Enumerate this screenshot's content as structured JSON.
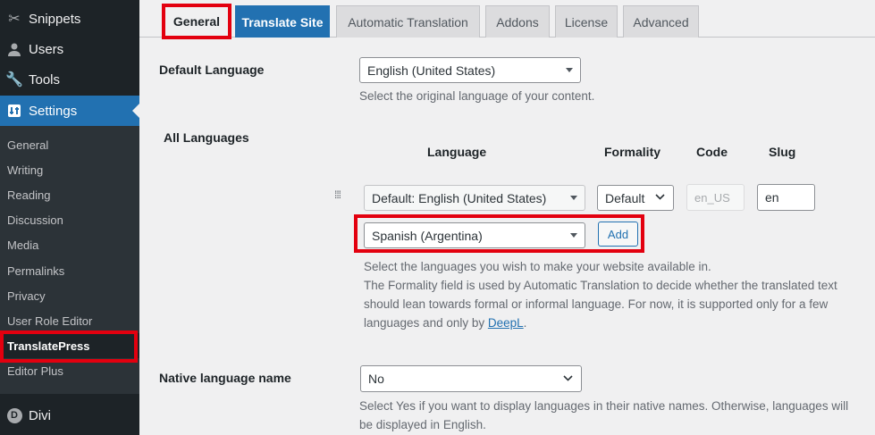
{
  "sidebar": {
    "menu": [
      {
        "label": "Snippets",
        "icon": "snippets-icon"
      },
      {
        "label": "Users",
        "icon": "users-icon"
      },
      {
        "label": "Tools",
        "icon": "wrench-icon"
      },
      {
        "label": "Settings",
        "icon": "settings-icon"
      }
    ],
    "submenu": [
      "General",
      "Writing",
      "Reading",
      "Discussion",
      "Media",
      "Permalinks",
      "Privacy",
      "User Role Editor",
      "TranslatePress",
      "Editor Plus"
    ],
    "divi": {
      "label": "Divi",
      "icon_letter": "D"
    }
  },
  "tabs": [
    "General",
    "Translate Site",
    "Automatic Translation",
    "Addons",
    "License",
    "Advanced"
  ],
  "default_language": {
    "label": "Default Language",
    "value": "English (United States)",
    "description": "Select the original language of your content."
  },
  "all_languages": {
    "label": "All Languages",
    "columns": {
      "language": "Language",
      "formality": "Formality",
      "code": "Code",
      "slug": "Slug"
    },
    "row": {
      "language": "Default: English (United States)",
      "formality": "Default",
      "code": "en_US",
      "slug": "en"
    },
    "new_language": "Spanish (Argentina)",
    "add_button": "Add",
    "desc_line1": "Select the languages you wish to make your website available in.",
    "desc_line2": "The Formality field is used by Automatic Translation to decide whether the translated text",
    "desc_line3": "should lean towards formal or informal language. For now, it is supported only for a few",
    "desc_line4_pre": "languages and only by ",
    "desc_link": "DeepL",
    "desc_line4_post": "."
  },
  "native_language": {
    "label": "Native language name",
    "value": "No",
    "desc_line1": "Select Yes if you want to display languages in their native names. Otherwise, languages will",
    "desc_line2": "be displayed in English."
  },
  "colors": {
    "accent": "#2271b1",
    "highlight": "#e3000f",
    "sidebar": "#1d2327"
  }
}
